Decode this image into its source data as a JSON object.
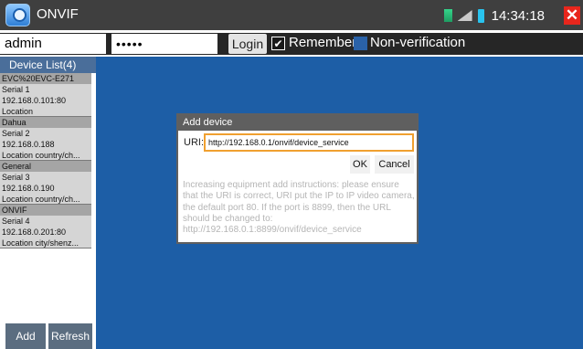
{
  "app": {
    "title": "ONVIF",
    "time": "14:34:18",
    "close_symbol": "✕"
  },
  "login": {
    "username": "admin",
    "password_mask": "•••••",
    "login_label": "Login",
    "remember_label": "Remember",
    "remember_checked": true,
    "nonverification_label": "Non-verification",
    "nonverification_checked": false
  },
  "sidebar": {
    "title": "Device List(4)",
    "devices": [
      {
        "name": "EVC%20EVC-E271",
        "serial": "Serial 1",
        "address": "192.168.0.101:80",
        "location": "Location"
      },
      {
        "name": "Dahua",
        "serial": "Serial 2",
        "address": "192.168.0.188",
        "location": "Location country/ch..."
      },
      {
        "name": "General",
        "serial": "Serial 3",
        "address": "192.168.0.190",
        "location": "Location country/ch..."
      },
      {
        "name": "ONVIF",
        "serial": "Serial 4",
        "address": "192.168.0.201:80",
        "location": "Location city/shenz..."
      }
    ],
    "add_label": "Add",
    "refresh_label": "Refresh"
  },
  "dialog": {
    "title": "Add device",
    "uri_label": "URI:",
    "uri_value": "http://192.168.0.1/onvif/device_service",
    "ok_label": "OK",
    "cancel_label": "Cancel",
    "instructions": "Increasing equipment add instructions: please ensure that the URI is correct, URI put the IP to IP video camera, the default port 80. If the port is 8899, then the URL should be changed to: http://192.168.0.1:8899/onvif/device_service"
  },
  "colors": {
    "titlebar": "#3f3f3f",
    "main_background": "#1d5ea6",
    "close_button": "#e8261c",
    "input_focus": "#f0a030"
  },
  "icons": [
    "app-logo-icon",
    "network-signal-icon",
    "wifi-icon",
    "battery-icon",
    "close-icon",
    "checkmark-icon"
  ]
}
